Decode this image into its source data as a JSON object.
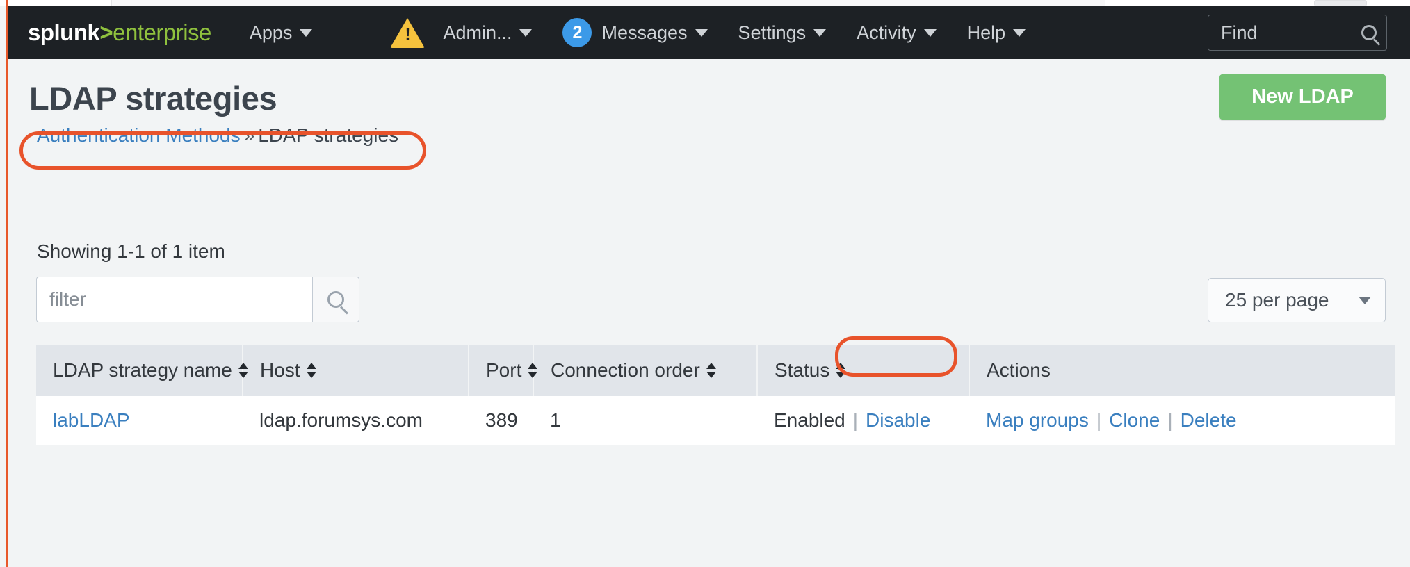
{
  "brand": {
    "name_primary": "splunk",
    "name_separator": ">",
    "name_secondary": "enterprise"
  },
  "topnav": {
    "apps": "Apps",
    "admin": "Admin...",
    "messages": "Messages",
    "messages_count": "2",
    "settings": "Settings",
    "activity": "Activity",
    "help": "Help",
    "find_placeholder": "Find",
    "warning_icon": "warning-triangle-icon",
    "search_icon": "search-icon",
    "badge_color": "#3c9ae8",
    "warning_color": "#f5c23d",
    "bar_color": "#1d2125"
  },
  "page": {
    "title": "LDAP strategies",
    "breadcrumb": {
      "parent": "Authentication Methods",
      "separator": "»",
      "current": "LDAP strategies"
    },
    "showing": "Showing 1-1 of 1 item",
    "new_button": "New LDAP",
    "new_button_color": "#74c274"
  },
  "filter": {
    "placeholder": "filter",
    "value": "",
    "search_icon": "search-icon"
  },
  "per_page": {
    "selected": "25 per page",
    "caret_icon": "chevron-down-icon"
  },
  "table": {
    "columns": [
      {
        "label": "LDAP strategy name",
        "sortable": true
      },
      {
        "label": "Host",
        "sortable": true
      },
      {
        "label": "Port",
        "sortable": true
      },
      {
        "label": "Connection order",
        "sortable": true
      },
      {
        "label": "Status",
        "sortable": true
      },
      {
        "label": "Actions",
        "sortable": false
      }
    ],
    "rows": [
      {
        "name": "labLDAP",
        "host": "ldap.forumsys.com",
        "port": "389",
        "connection_order": "1",
        "status_text": "Enabled",
        "status_action": "Disable",
        "actions": [
          "Map groups",
          "Clone",
          "Delete"
        ]
      }
    ]
  },
  "annotations": {
    "color": "#e8532b",
    "highlighted": [
      "breadcrumb",
      "map-groups-link"
    ]
  }
}
